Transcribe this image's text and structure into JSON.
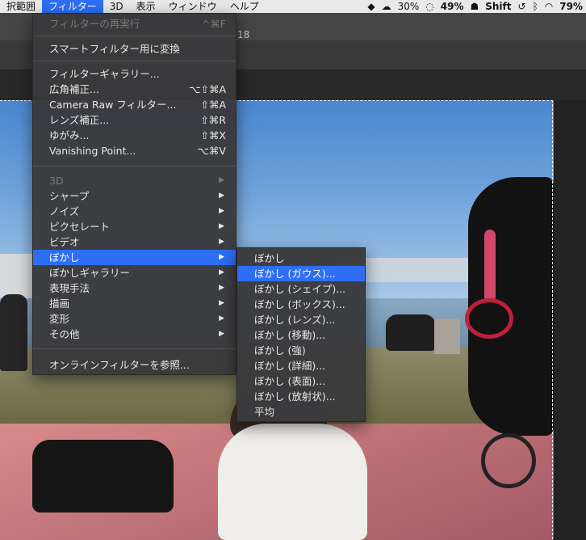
{
  "menubar": {
    "items": [
      "択範囲",
      "フィルター",
      "3D",
      "表示",
      "ウィンドウ",
      "ヘルプ"
    ],
    "active_index": 1,
    "status": {
      "battery_percent": "30%",
      "cpu_percent": "49%",
      "shift_label": "Shift",
      "battery2_percent": "79%"
    }
  },
  "document": {
    "tab_fragment": "18"
  },
  "filter_menu": {
    "items": [
      {
        "label": "フィルターの再実行",
        "shortcut": "^⌘F",
        "disabled": true
      },
      {
        "label": "スマートフィルター用に変換"
      },
      {
        "label": "フィルターギャラリー..."
      },
      {
        "label": "広角補正...",
        "shortcut": "⌥⇧⌘A"
      },
      {
        "label": "Camera Raw フィルター...",
        "shortcut": "⇧⌘A"
      },
      {
        "label": "レンズ補正...",
        "shortcut": "⇧⌘R"
      },
      {
        "label": "ゆがみ...",
        "shortcut": "⇧⌘X"
      },
      {
        "label": "Vanishing Point...",
        "shortcut": "⌥⌘V"
      },
      {
        "label": "3D",
        "submenu": true,
        "disabled": true
      },
      {
        "label": "シャープ",
        "submenu": true
      },
      {
        "label": "ノイズ",
        "submenu": true
      },
      {
        "label": "ピクセレート",
        "submenu": true
      },
      {
        "label": "ビデオ",
        "submenu": true
      },
      {
        "label": "ぼかし",
        "submenu": true,
        "selected": true
      },
      {
        "label": "ぼかしギャラリー",
        "submenu": true
      },
      {
        "label": "表現手法",
        "submenu": true
      },
      {
        "label": "描画",
        "submenu": true
      },
      {
        "label": "変形",
        "submenu": true
      },
      {
        "label": "その他",
        "submenu": true
      },
      {
        "label": "オンラインフィルターを参照..."
      }
    ]
  },
  "blur_submenu": {
    "items": [
      {
        "label": "ぼかし"
      },
      {
        "label": "ぼかし (ガウス)...",
        "selected": true
      },
      {
        "label": "ぼかし (シェイプ)..."
      },
      {
        "label": "ぼかし (ボックス)..."
      },
      {
        "label": "ぼかし (レンズ)..."
      },
      {
        "label": "ぼかし (移動)..."
      },
      {
        "label": "ぼかし (強)"
      },
      {
        "label": "ぼかし (詳細)..."
      },
      {
        "label": "ぼかし (表面)..."
      },
      {
        "label": "ぼかし (放射状)..."
      },
      {
        "label": "平均"
      }
    ]
  },
  "colors": {
    "menu_bg": "#3a3a3c",
    "highlight": "#2d6ef5",
    "menubar_bg": "#e9e9e9"
  }
}
